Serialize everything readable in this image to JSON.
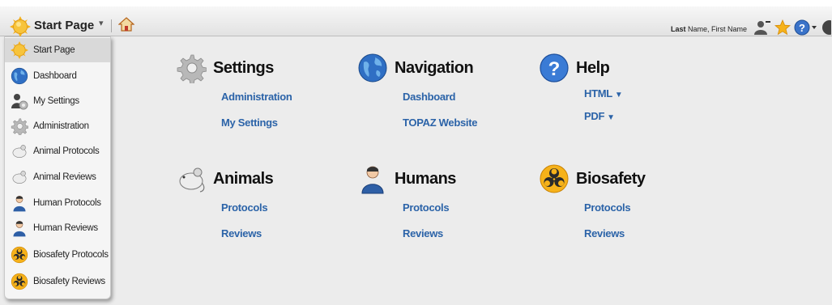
{
  "header": {
    "title": "Start Page",
    "user_bold": "Last",
    "user_rest": " Name, First Name"
  },
  "menu": {
    "items": [
      {
        "label": "Start Page",
        "icon": "sun-icon"
      },
      {
        "label": "Dashboard",
        "icon": "globe-icon"
      },
      {
        "label": "My Settings",
        "icon": "user-gear-icon"
      },
      {
        "label": "Administration",
        "icon": "gear-icon"
      },
      {
        "label": "Animal Protocols",
        "icon": "mouse-icon"
      },
      {
        "label": "Animal Reviews",
        "icon": "mouse-icon"
      },
      {
        "label": "Human Protocols",
        "icon": "person-icon"
      },
      {
        "label": "Human Reviews",
        "icon": "person-icon"
      },
      {
        "label": "Biosafety Protocols",
        "icon": "biohazard-icon"
      },
      {
        "label": "Biosafety Reviews",
        "icon": "biohazard-icon"
      }
    ]
  },
  "sections": {
    "settings": {
      "title": "Settings",
      "links": [
        "Administration",
        "My Settings"
      ]
    },
    "navigation": {
      "title": "Navigation",
      "links": [
        "Dashboard",
        "TOPAZ Website"
      ]
    },
    "help": {
      "title": "Help",
      "links": [
        "HTML",
        "PDF"
      ]
    },
    "animals": {
      "title": "Animals",
      "links": [
        "Protocols",
        "Reviews"
      ]
    },
    "humans": {
      "title": "Humans",
      "links": [
        "Protocols",
        "Reviews"
      ]
    },
    "biosafety": {
      "title": "Biosafety",
      "links": [
        "Protocols",
        "Reviews"
      ]
    }
  },
  "colors": {
    "link": "#2b63a8",
    "menu_active": "#d9d9d9",
    "background": "#ececec"
  }
}
